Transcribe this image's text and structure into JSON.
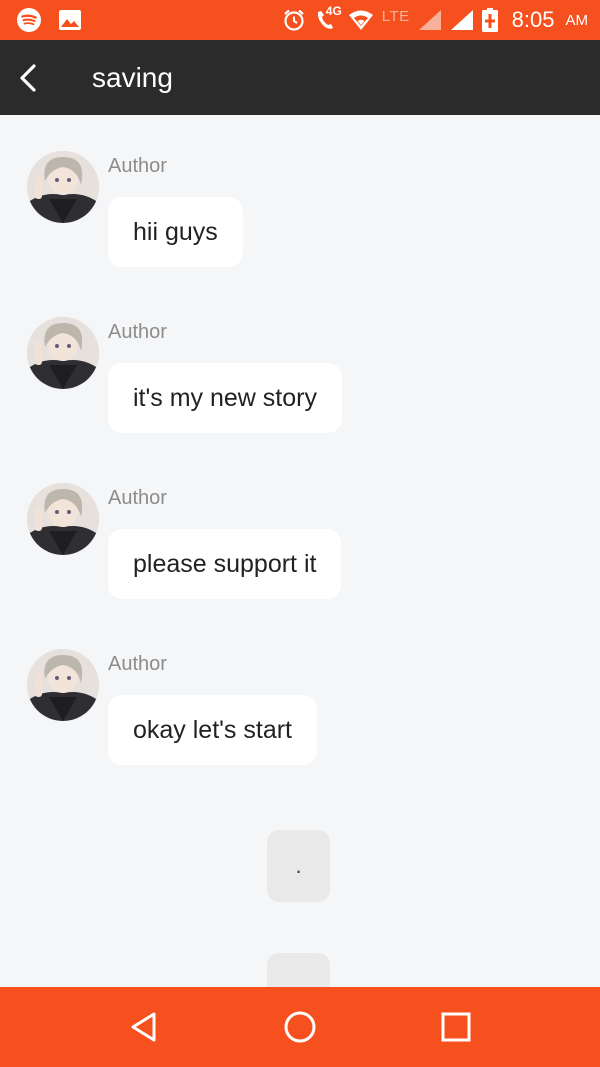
{
  "status_bar": {
    "network_label": "4G",
    "lte_label": "LTE",
    "time": "8:05",
    "ampm": "AM",
    "icons": [
      "spotify-icon",
      "image-icon",
      "alarm-icon",
      "volte-call-icon",
      "wifi-icon",
      "signal-icon",
      "signal-icon",
      "battery-charging-icon"
    ]
  },
  "toolbar": {
    "title": "saving",
    "back_icon": "chevron-left-icon"
  },
  "messages": [
    {
      "author": "Author",
      "text": "hii guys"
    },
    {
      "author": "Author",
      "text": "it's my new story"
    },
    {
      "author": "Author",
      "text": "please support it"
    },
    {
      "author": "Author",
      "text": "okay let's start"
    }
  ],
  "narration": [
    {
      "text": "."
    },
    {
      "text": ""
    }
  ],
  "nav": {
    "icons": [
      "back-triangle-icon",
      "home-circle-icon",
      "recents-square-icon"
    ]
  },
  "colors": {
    "accent": "#f5501e",
    "toolbar": "#2b2b2b",
    "background": "#f5f6f8",
    "bubble": "#ffffff",
    "author_text": "#8c8c8c"
  }
}
